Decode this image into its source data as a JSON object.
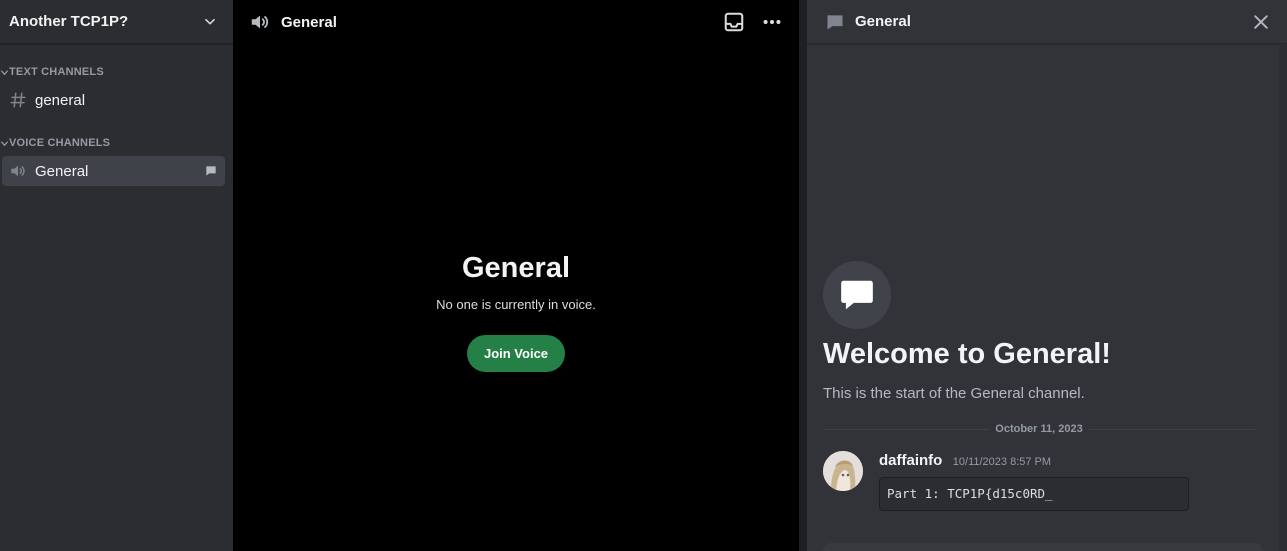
{
  "server": {
    "name": "Another TCP1P?",
    "menu_icon": "chevron-down-icon"
  },
  "sidebar": {
    "categories": [
      {
        "label": "TEXT CHANNELS",
        "channels": [
          {
            "name": "general",
            "icon": "hashtag-icon"
          }
        ]
      },
      {
        "label": "VOICE CHANNELS",
        "channels": [
          {
            "name": "General",
            "icon": "speaker-icon",
            "active": true
          }
        ]
      }
    ]
  },
  "stage": {
    "title": "General",
    "heading": "General",
    "status": "No one is currently in voice.",
    "join_label": "Join Voice",
    "accent": "#248046"
  },
  "chat": {
    "title": "General",
    "welcome_title": "Welcome to General!",
    "welcome_sub": "This is the start of the General channel.",
    "date": "October 11, 2023",
    "messages": [
      {
        "author": "daffainfo",
        "timestamp": "10/11/2023 8:57 PM",
        "code": "Part 1: TCP1P{d15c0RD_"
      }
    ]
  },
  "colors": {
    "sidebar": "#2b2d31",
    "chat": "#313338",
    "stage": "#000000"
  }
}
